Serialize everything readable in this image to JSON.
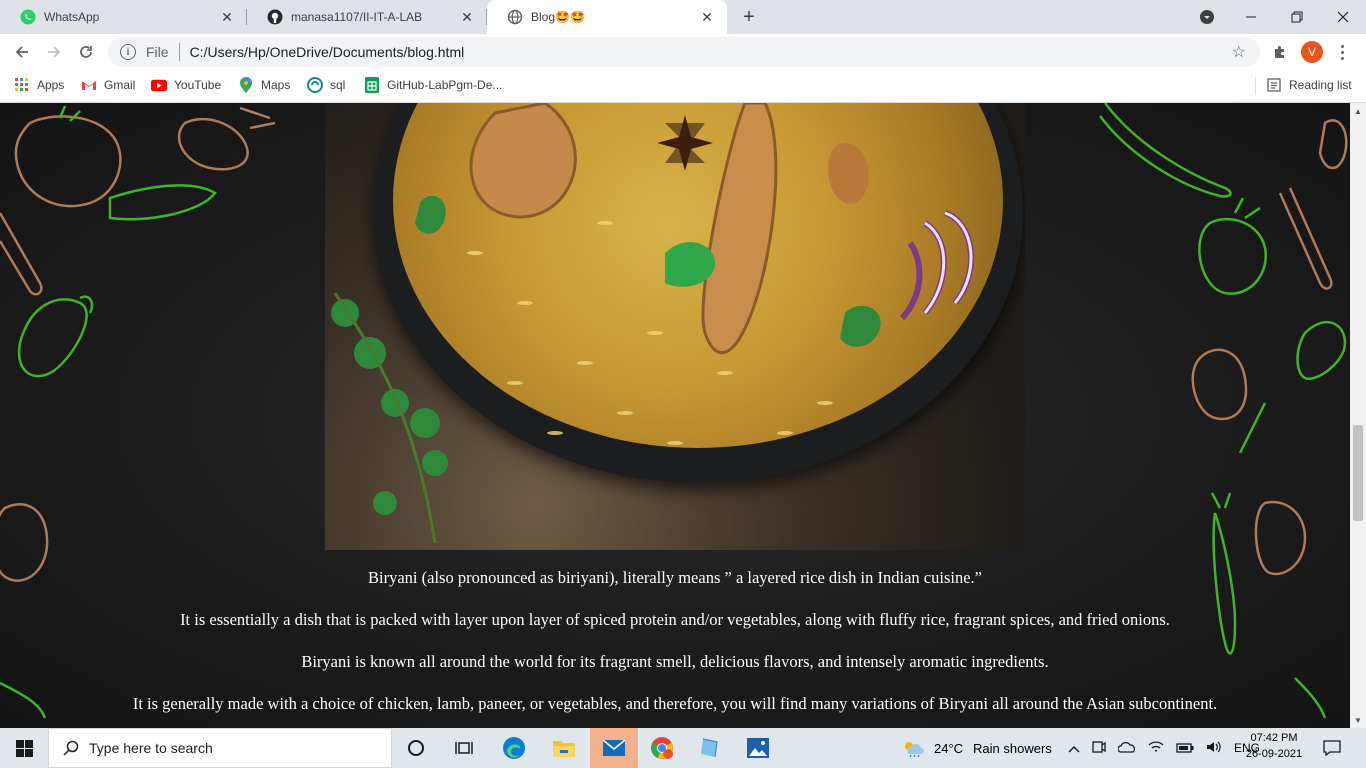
{
  "browser": {
    "tabs": [
      {
        "title": "WhatsApp",
        "icon": "whatsapp-icon",
        "active": false
      },
      {
        "title": "manasa1107/II-IT-A-LAB",
        "icon": "github-icon",
        "active": false
      },
      {
        "title": "Blog🤩🤩",
        "icon": "globe-icon",
        "active": true
      }
    ],
    "new_tab_label": "+",
    "address": {
      "info_label": "i",
      "scheme_label": "File",
      "url": "C:/Users/Hp/OneDrive/Documents/blog.html"
    },
    "profile_initial": "V",
    "bookmarks": [
      {
        "label": "Apps",
        "icon": "apps-grid-icon"
      },
      {
        "label": "Gmail",
        "icon": "gmail-icon"
      },
      {
        "label": "YouTube",
        "icon": "youtube-icon"
      },
      {
        "label": "Maps",
        "icon": "maps-icon"
      },
      {
        "label": "sql",
        "icon": "sql-icon"
      },
      {
        "label": "GitHub-LabPgm-De...",
        "icon": "sheets-icon"
      }
    ],
    "reading_list_label": "Reading list"
  },
  "page": {
    "paragraphs": [
      "Biryani (also pronounced as biriyani), literally means ” a layered rice dish in Indian cuisine.”",
      "It is essentially a dish that is packed with layer upon layer of spiced protein and/or vegetables, along with fluffy rice, fragrant spices, and fried onions.",
      "Biryani is known all around the world for its fragrant smell, delicious flavors, and intensely aromatic ingredients.",
      "It is generally made with a choice of chicken, lamb, paneer, or vegetables, and therefore, you will find many variations of Biryani all around the Asian subcontinent."
    ],
    "colors": {
      "text": "#ffffff",
      "background": "#1b1b1b",
      "doodle_green": "#3fb526",
      "doodle_brown": "#b07a54"
    }
  },
  "taskbar": {
    "search_placeholder": "Type here to search",
    "weather_temp": "24°C",
    "weather_text": "Rain showers",
    "language": "ENG",
    "time": "07:42 PM",
    "date": "26-09-2021"
  }
}
